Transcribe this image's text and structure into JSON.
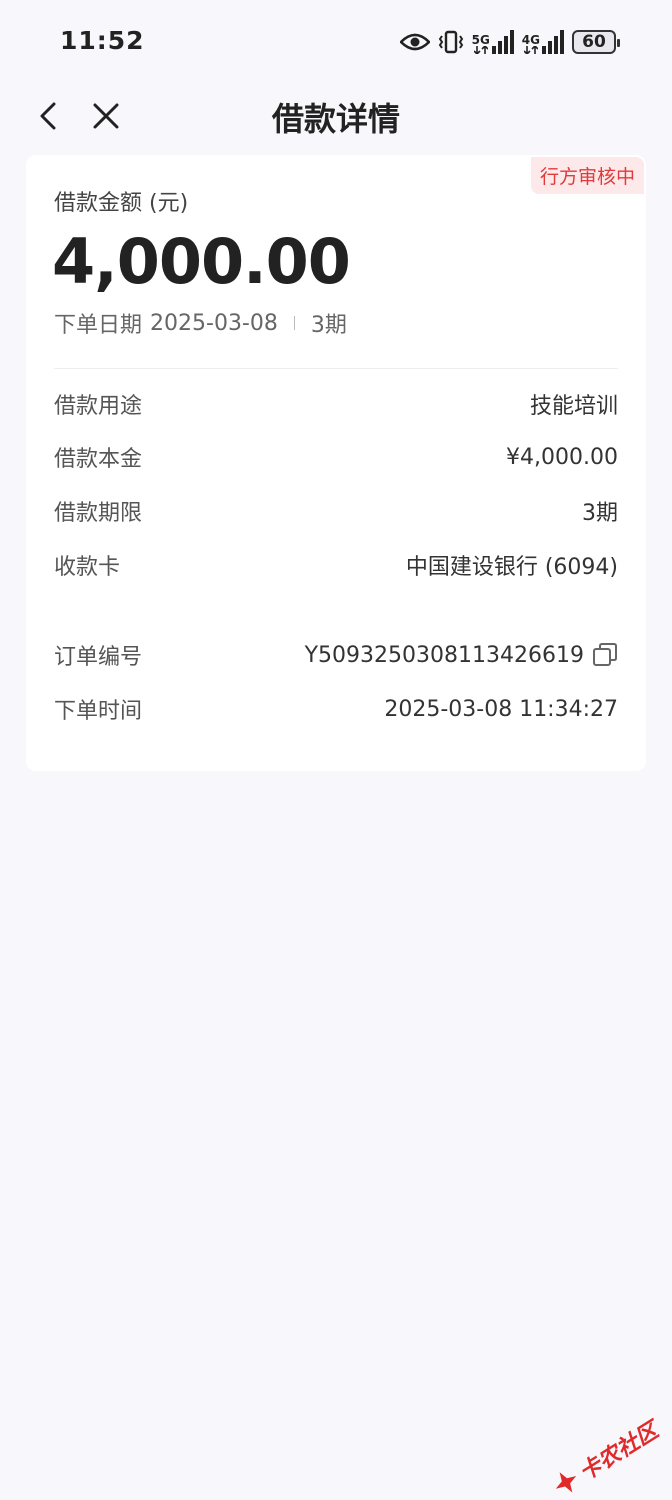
{
  "status_bar": {
    "time": "11:52",
    "net_5g": "5G",
    "net_4g": "4G",
    "battery": "60"
  },
  "nav": {
    "title": "借款详情"
  },
  "card": {
    "status_badge": "行方审核中",
    "amount_label": "借款金额 (元)",
    "amount_value": "4,000.00",
    "order_date_label": "下单日期",
    "order_date": "2025-03-08",
    "term_short": "3期",
    "details": [
      {
        "label": "借款用途",
        "value": "技能培训"
      },
      {
        "label": "借款本金",
        "value": "¥4,000.00"
      },
      {
        "label": "借款期限",
        "value": "3期"
      },
      {
        "label": "收款卡",
        "value": "中国建设银行 (6094)"
      }
    ],
    "order_no_label": "订单编号",
    "order_no": "Y5093250308113426619",
    "order_time_label": "下单时间",
    "order_time": "2025-03-08 11:34:27"
  },
  "watermark": {
    "text": "卡农社区"
  },
  "colors": {
    "background": "#f7f7fc",
    "badge_bg": "#fde8ea",
    "badge_text": "#e23a3a",
    "watermark": "#e02a2a"
  }
}
